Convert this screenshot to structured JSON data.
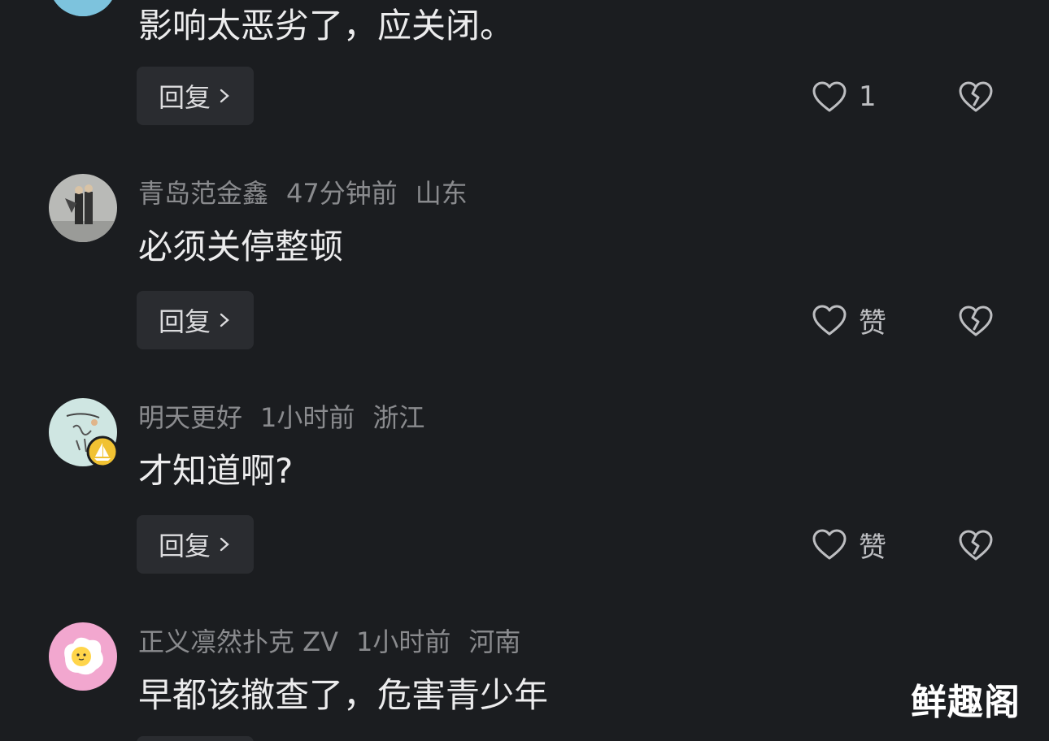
{
  "comments": [
    {
      "text": "影响太恶劣了，应关闭。",
      "reply_label": "回复",
      "like_label": "1",
      "avatar_icon": "avatar-photo-blue"
    },
    {
      "username": "青岛范金鑫",
      "time": "47分钟前",
      "location": "山东",
      "text": "必须关停整顿",
      "reply_label": "回复",
      "like_label": "赞",
      "avatar_icon": "avatar-photo-people"
    },
    {
      "username": "明天更好",
      "time": "1小时前",
      "location": "浙江",
      "text": "才知道啊?",
      "reply_label": "回复",
      "like_label": "赞",
      "avatar_icon": "avatar-calligraphy",
      "badge_icon": "sailboat-badge-icon"
    },
    {
      "username": "正义凛然扑克 ZV",
      "time": "1小时前",
      "location": "河南",
      "text": "早都该撤查了，危害青少年",
      "avatar_icon": "avatar-fried-egg"
    }
  ],
  "watermark": "鲜趣阁",
  "colors": {
    "background": "#1b1d20",
    "button_bg": "#2a2c30",
    "meta_text": "#8a8b8e",
    "body_text": "#ececed",
    "badge": "#f1c232"
  }
}
